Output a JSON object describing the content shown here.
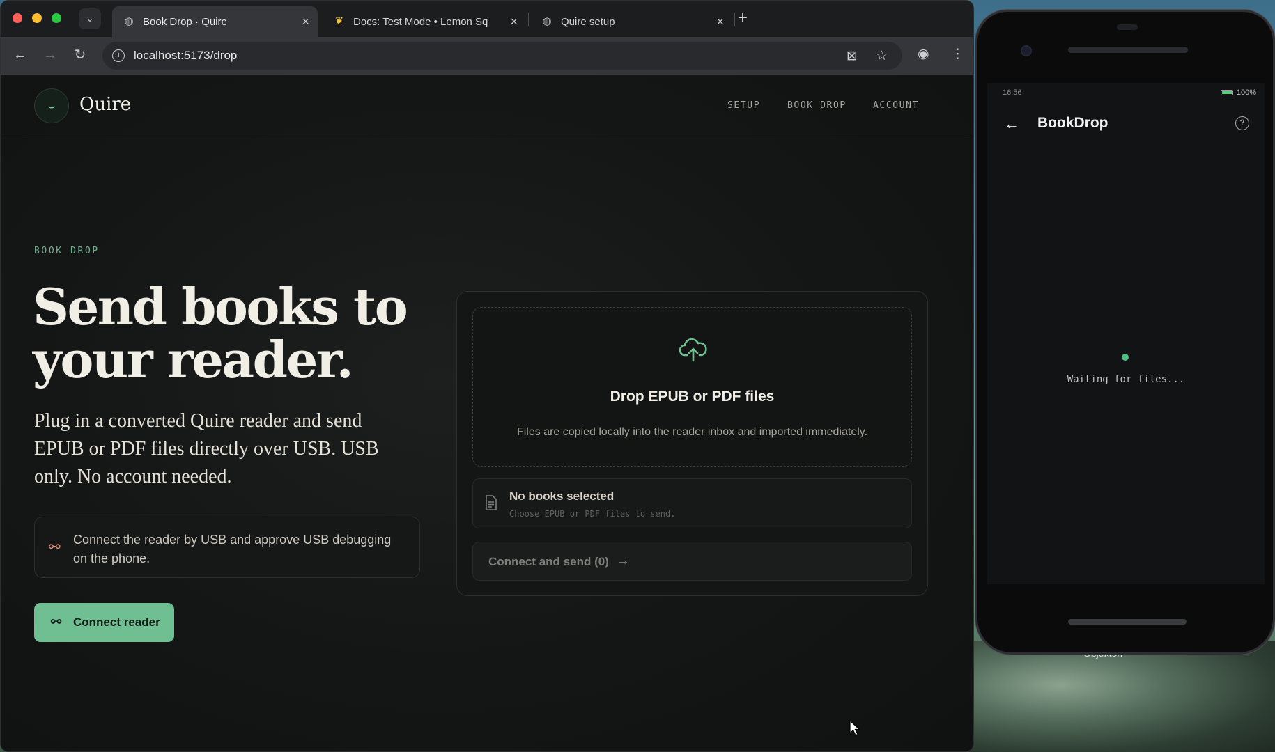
{
  "browser": {
    "tabs": [
      {
        "title": "Book Drop · Quire",
        "active": true
      },
      {
        "title": "Docs: Test Mode • Lemon Sq",
        "active": false
      },
      {
        "title": "Quire setup",
        "active": false
      }
    ],
    "url": "localhost:5173/drop"
  },
  "site": {
    "brand": "Quire",
    "nav": [
      "SETUP",
      "BOOK DROP",
      "ACCOUNT"
    ]
  },
  "hero": {
    "eyebrow": "BOOK DROP",
    "title": "Send books to your reader.",
    "subtitle": "Plug in a converted Quire reader and send EPUB or PDF files directly over USB. USB only. No account needed."
  },
  "notice": {
    "text": "Connect the reader by USB and approve USB debugging on the phone."
  },
  "actions": {
    "connect_label": "Connect reader",
    "send_label": "Connect and send (0)"
  },
  "dropzone": {
    "title": "Drop EPUB or PDF files",
    "description": "Files are copied locally into the reader inbox and imported immediately."
  },
  "file_summary": {
    "title": "No books selected",
    "subtitle": "Choose EPUB or PDF files to send."
  },
  "phone": {
    "time": "16:56",
    "battery": "100%",
    "app_title": "BookDrop",
    "status": "Waiting for files..."
  },
  "desktop": {
    "label": "Objekten"
  },
  "colors": {
    "accent": "#6fbf92",
    "background": "#121514",
    "usb_icon": "#e08b74"
  }
}
